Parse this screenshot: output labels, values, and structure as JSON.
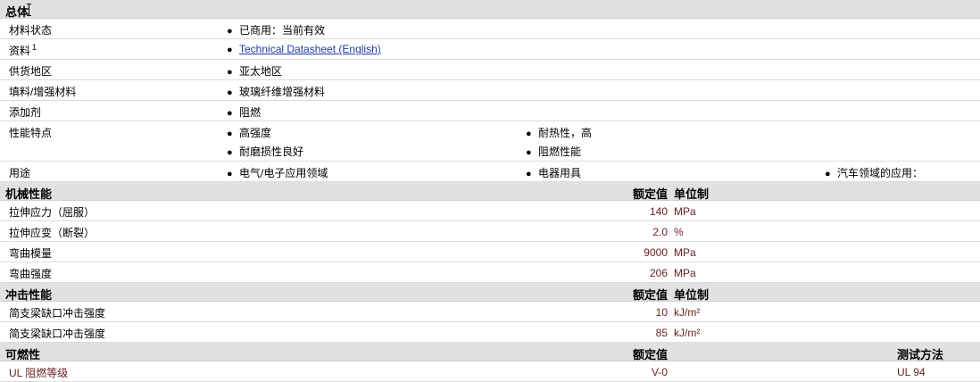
{
  "general": {
    "title": "总体",
    "rows": [
      {
        "label": "材料状态",
        "items": [
          "已商用：当前有效"
        ]
      },
      {
        "label": "资料",
        "sup": "1",
        "items": [
          "Technical Datasheet (English)"
        ]
      },
      {
        "label": "供货地区",
        "items": [
          "亚太地区"
        ]
      },
      {
        "label": "填料/增强材料",
        "items": [
          "玻璃纤维增强材料"
        ]
      },
      {
        "label": "添加剂",
        "items": [
          "阻燃"
        ]
      },
      {
        "label": "性能特点",
        "items": [
          "高强度",
          "耐热性，高",
          "耐磨损性良好",
          "阻燃性能"
        ]
      },
      {
        "label": "用途",
        "items": [
          "电气/电子应用领域",
          "电器用具",
          "汽车领域的应用："
        ]
      }
    ]
  },
  "mechanical": {
    "title": "机械性能",
    "col_value": "额定值",
    "col_unit": "单位制",
    "rows": [
      {
        "label": "拉伸应力（屈服）",
        "value": "140",
        "unit": "MPa"
      },
      {
        "label": "拉伸应变（断裂）",
        "value": "2.0",
        "unit": "%"
      },
      {
        "label": "弯曲模量",
        "value": "9000",
        "unit": "MPa"
      },
      {
        "label": "弯曲强度",
        "value": "206",
        "unit": "MPa"
      }
    ]
  },
  "impact": {
    "title": "冲击性能",
    "col_value": "额定值",
    "col_unit": "单位制",
    "rows": [
      {
        "label": "简支梁缺口冲击强度",
        "value": "10",
        "unit": "kJ/m²"
      },
      {
        "label": "简支梁缺口冲击强度",
        "value": "85",
        "unit": "kJ/m²"
      }
    ]
  },
  "flammability": {
    "title": "可燃性",
    "col_value": "额定值",
    "col_method": "测试方法",
    "rows": [
      {
        "label": "UL 阻燃等级",
        "value": "V-0",
        "method": "UL 94"
      }
    ]
  },
  "bullet": "●"
}
